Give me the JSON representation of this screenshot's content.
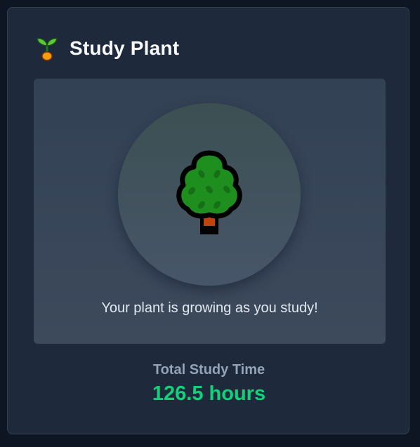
{
  "header": {
    "icon": "seedling-icon",
    "title": "Study Plant"
  },
  "plant": {
    "icon": "tree-icon",
    "caption": "Your plant is growing as you study!"
  },
  "stats": {
    "label": "Total Study Time",
    "value": "126.5 hours"
  },
  "colors": {
    "background": "#0f1623",
    "card": "#1e293b",
    "panel": "#334155",
    "accent": "#10d27a",
    "muted": "#94a3b8"
  }
}
